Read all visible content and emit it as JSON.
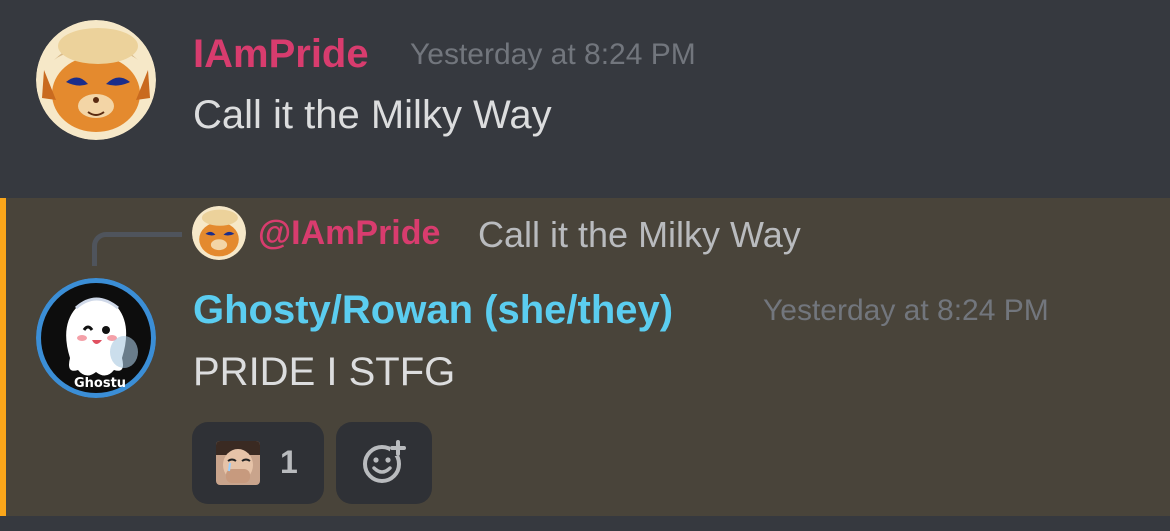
{
  "messages": [
    {
      "username": "IAmPride",
      "username_color": "#d83c6e",
      "timestamp": "Yesterday at 8:24 PM",
      "content": "Call it the Milky Way"
    },
    {
      "reply": {
        "mention": "@IAmPride",
        "text": "Call it the Milky Way"
      },
      "username": "Ghosty/Rowan (she/they)",
      "username_color": "#5bcdf0",
      "timestamp": "Yesterday at 8:24 PM",
      "content": "PRIDE I STFG",
      "avatar_caption": "Ghostu",
      "reactions": [
        {
          "emoji": "crying-face-photo-emoji",
          "count": "1"
        }
      ]
    }
  ],
  "colors": {
    "background": "#36393f",
    "mention_highlight": "#49443a",
    "mention_bar": "#faa61a",
    "reaction_bg": "#2f3136"
  }
}
